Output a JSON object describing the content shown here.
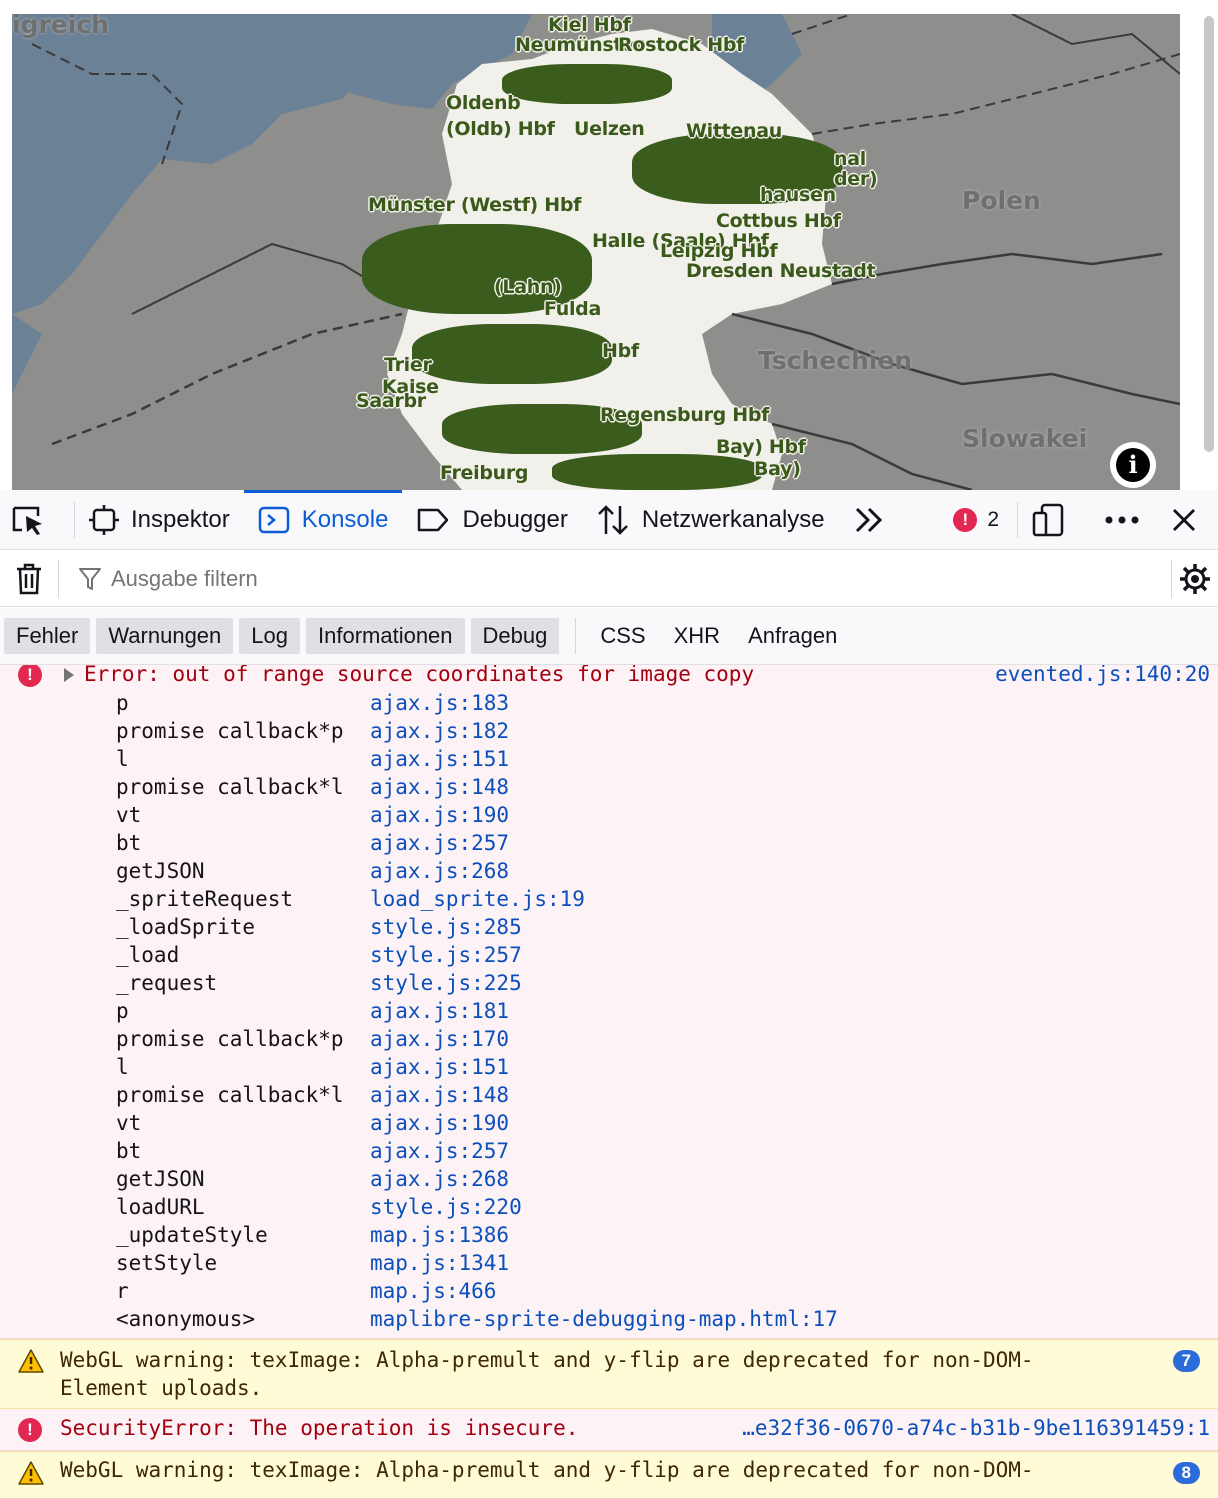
{
  "map": {
    "country_labels": [
      "igreich",
      "Polen",
      "Tschechien",
      "Slowakei"
    ],
    "city_labels": [
      "Kiel Hbf",
      "Neumünster",
      "Rostock Hbf",
      "Oldenb",
      "(Oldb) Hbf",
      "Uelzen",
      "Wittenau",
      "Münster (Westf) Hbf",
      "Cottbus Hbf",
      "Halle (Saale) Hbf",
      "Leipzig Hbf",
      "Dresden Neustadt",
      "(Lahn)",
      "Fulda",
      "Trier",
      "Kaise",
      "Saarbr",
      "Regensburg Hbf",
      "Freiburg",
      "nal",
      "der)",
      "hausen",
      "Bay)",
      "Bay) Hbf",
      "Hbf"
    ],
    "info_button": "i"
  },
  "devtools": {
    "tabs": [
      {
        "label": "Inspektor",
        "icon": "inspector-icon"
      },
      {
        "label": "Konsole",
        "icon": "console-icon",
        "selected": true
      },
      {
        "label": "Debugger",
        "icon": "debugger-icon"
      },
      {
        "label": "Netzwerkanalyse",
        "icon": "network-icon"
      }
    ],
    "error_count": "2",
    "filter_placeholder": "Ausgabe filtern",
    "categories": [
      "Fehler",
      "Warnungen",
      "Log",
      "Informationen",
      "Debug"
    ],
    "categories_plain": [
      "CSS",
      "XHR",
      "Anfragen"
    ]
  },
  "console": {
    "error1": {
      "message": "Error: out of range source coordinates for image copy",
      "source": "evented.js:140:20",
      "stack": [
        {
          "fn": "p",
          "loc": "ajax.js:183"
        },
        {
          "fn": "promise callback*p",
          "loc": "ajax.js:182"
        },
        {
          "fn": "l",
          "loc": "ajax.js:151"
        },
        {
          "fn": "promise callback*l",
          "loc": "ajax.js:148"
        },
        {
          "fn": "vt",
          "loc": "ajax.js:190"
        },
        {
          "fn": "bt",
          "loc": "ajax.js:257"
        },
        {
          "fn": "getJSON",
          "loc": "ajax.js:268"
        },
        {
          "fn": "_spriteRequest",
          "loc": "load_sprite.js:19"
        },
        {
          "fn": "_loadSprite",
          "loc": "style.js:285"
        },
        {
          "fn": "_load",
          "loc": "style.js:257"
        },
        {
          "fn": "_request",
          "loc": "style.js:225"
        },
        {
          "fn": "p",
          "loc": "ajax.js:181"
        },
        {
          "fn": "promise callback*p",
          "loc": "ajax.js:170"
        },
        {
          "fn": "l",
          "loc": "ajax.js:151"
        },
        {
          "fn": "promise callback*l",
          "loc": "ajax.js:148"
        },
        {
          "fn": "vt",
          "loc": "ajax.js:190"
        },
        {
          "fn": "bt",
          "loc": "ajax.js:257"
        },
        {
          "fn": "getJSON",
          "loc": "ajax.js:268"
        },
        {
          "fn": "loadURL",
          "loc": "style.js:220"
        },
        {
          "fn": "_updateStyle",
          "loc": "map.js:1386"
        },
        {
          "fn": "setStyle",
          "loc": "map.js:1341"
        },
        {
          "fn": "r",
          "loc": "map.js:466"
        },
        {
          "fn": "<anonymous>",
          "loc": "maplibre-sprite-debugging-map.html:17"
        }
      ]
    },
    "warn1": {
      "line1": "WebGL warning: texImage: Alpha-premult and y-flip are deprecated for non-DOM-",
      "line2": "Element uploads.",
      "count": "7"
    },
    "error2": {
      "message": "SecurityError: The operation is insecure.",
      "source": "…e32f36-0670-a74c-b31b-9be116391459:1"
    },
    "warn2": {
      "line1": "WebGL warning: texImage: Alpha-premult and y-flip are deprecated for non-DOM-",
      "count": "8"
    }
  }
}
